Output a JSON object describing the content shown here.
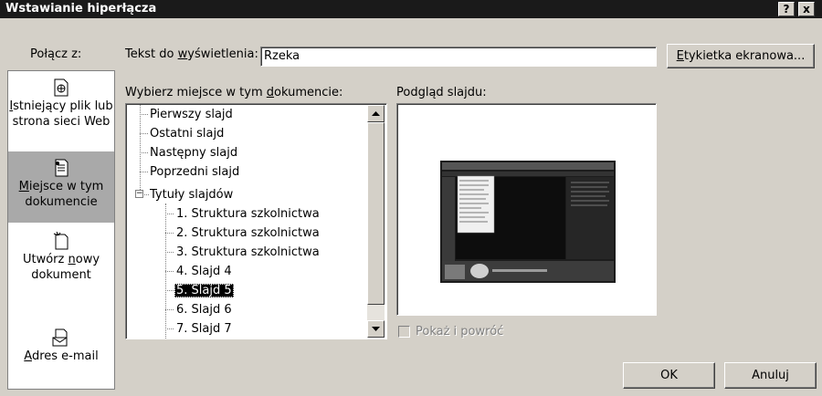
{
  "dialog": {
    "title": "Wstawianie hiperłącza",
    "help_button": "?",
    "close_button": "x"
  },
  "sidebar": {
    "label": "Połącz z:",
    "items": [
      {
        "key": "I",
        "rest": "stniejący plik lub strona sieci Web"
      },
      {
        "key": "M",
        "rest": "iejsce w tym dokumencie",
        "selected": true
      },
      {
        "pre": "Utwórz ",
        "key": "n",
        "rest": "owy dokument"
      },
      {
        "key": "A",
        "rest": "dres e-mail"
      }
    ]
  },
  "display_text": {
    "label_pre": "Tekst do ",
    "label_key": "w",
    "label_rest": "yświetlenia:",
    "value": "Rzeka"
  },
  "screen_tip_button": {
    "key": "E",
    "rest": "tykietka ekranowa..."
  },
  "place_list": {
    "label_pre": "Wybierz miejsce w tym ",
    "label_key": "d",
    "label_rest": "okumencie:",
    "items": [
      "Pierwszy slajd",
      "Ostatni slajd",
      "Następny slajd",
      "Poprzedni slajd",
      "Tytuły slajdów",
      "1. Struktura szkolnictwa",
      "2. Struktura szkolnictwa",
      "3. Struktura szkolnictwa",
      "4. Slajd 4",
      "5. Slajd 5",
      "6. Slajd 6",
      "7. Slajd 7"
    ],
    "selected": "5. Slajd 5",
    "expander": "−"
  },
  "preview": {
    "label": "Podgląd slajdu:",
    "show_and_return": "Pokaż i powróć"
  },
  "buttons": {
    "ok": "OK",
    "cancel": "Anuluj"
  },
  "colors": {
    "title_bar": "#1a1a1a",
    "dialog_bg": "#d4d0c8",
    "selection": "#000000"
  }
}
